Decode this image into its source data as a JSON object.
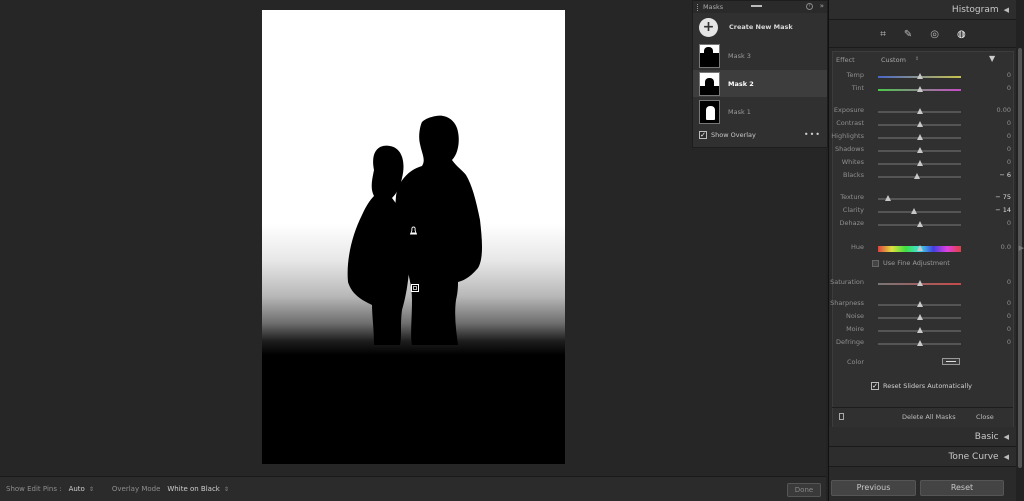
{
  "masks_panel": {
    "title": "Masks",
    "create_label": "Create New Mask",
    "masks": [
      {
        "label": "Mask 3",
        "selected": false
      },
      {
        "label": "Mask 2",
        "selected": true
      },
      {
        "label": "Mask 1",
        "selected": false
      }
    ],
    "show_overlay_label": "Show Overlay",
    "show_overlay_checked": true,
    "more_icon": "ellipsis-icon"
  },
  "bottom_bar": {
    "show_edit_pins_label": "Show Edit Pins :",
    "show_edit_pins_value": "Auto",
    "overlay_mode_label": "Overlay Mode",
    "overlay_mode_value": "White on Black",
    "done_label": "Done"
  },
  "right_panel": {
    "histogram_label": "Histogram",
    "tools": [
      "crop-icon",
      "healing-icon",
      "redeye-icon",
      "masking-icon"
    ],
    "effect": {
      "label": "Effect",
      "value": "Custom"
    },
    "sliders": [
      {
        "name": "Temp",
        "value": "0",
        "pos": 0.5,
        "gradient": "temp"
      },
      {
        "name": "Tint",
        "value": "0",
        "pos": 0.5,
        "gradient": "tint"
      },
      {
        "name": "Exposure",
        "value": "0.00",
        "pos": 0.5
      },
      {
        "name": "Contrast",
        "value": "0",
        "pos": 0.5
      },
      {
        "name": "Highlights",
        "value": "0",
        "pos": 0.5
      },
      {
        "name": "Shadows",
        "value": "0",
        "pos": 0.5
      },
      {
        "name": "Whites",
        "value": "0",
        "pos": 0.5
      },
      {
        "name": "Blacks",
        "value": "− 6",
        "pos": 0.47
      },
      {
        "name": "Texture",
        "value": "− 75",
        "pos": 0.125
      },
      {
        "name": "Clarity",
        "value": "− 14",
        "pos": 0.43
      },
      {
        "name": "Dehaze",
        "value": "0",
        "pos": 0.5
      },
      {
        "name": "Hue",
        "value": "0.0",
        "pos": 0.5,
        "gradient": "hue"
      },
      {
        "name": "Saturation",
        "value": "0",
        "pos": 0.5,
        "gradient": "sat"
      },
      {
        "name": "Sharpness",
        "value": "0",
        "pos": 0.5
      },
      {
        "name": "Noise",
        "value": "0",
        "pos": 0.5
      },
      {
        "name": "Moire",
        "value": "0",
        "pos": 0.5
      },
      {
        "name": "Defringe",
        "value": "0",
        "pos": 0.5
      }
    ],
    "fine_adjustment_label": "Use Fine Adjustment",
    "color_label": "Color",
    "reset_sliders_label": "Reset Sliders Automatically",
    "delete_all_label": "Delete All Masks",
    "close_label": "Close",
    "basic_label": "Basic",
    "tone_curve_label": "Tone Curve",
    "previous_label": "Previous",
    "reset_label": "Reset"
  }
}
